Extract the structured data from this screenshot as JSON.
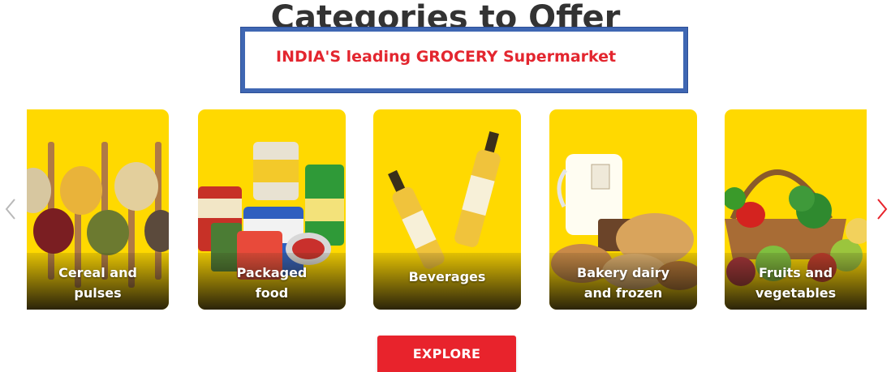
{
  "section": {
    "title": "Categories to Offer"
  },
  "banner": {
    "text": "INDIA'S leading GROCERY Supermarket"
  },
  "carousel": {
    "prev_icon": "chevron-left-icon",
    "next_icon": "chevron-right-icon",
    "cards": [
      {
        "line1": "Cereal and",
        "line2": "pulses"
      },
      {
        "line1": "Packaged",
        "line2": "food"
      },
      {
        "line1": "Beverages",
        "line2": ""
      },
      {
        "line1": "Bakery dairy",
        "line2": "and frozen"
      },
      {
        "line1": "Fruits and",
        "line2": "vegetables"
      }
    ]
  },
  "explore": {
    "label": "EXPLORE"
  },
  "colors": {
    "card_bg": "#ffd900",
    "accent": "#e8232c",
    "banner_border": "#3f67b3",
    "banner_text": "#e3262f"
  }
}
